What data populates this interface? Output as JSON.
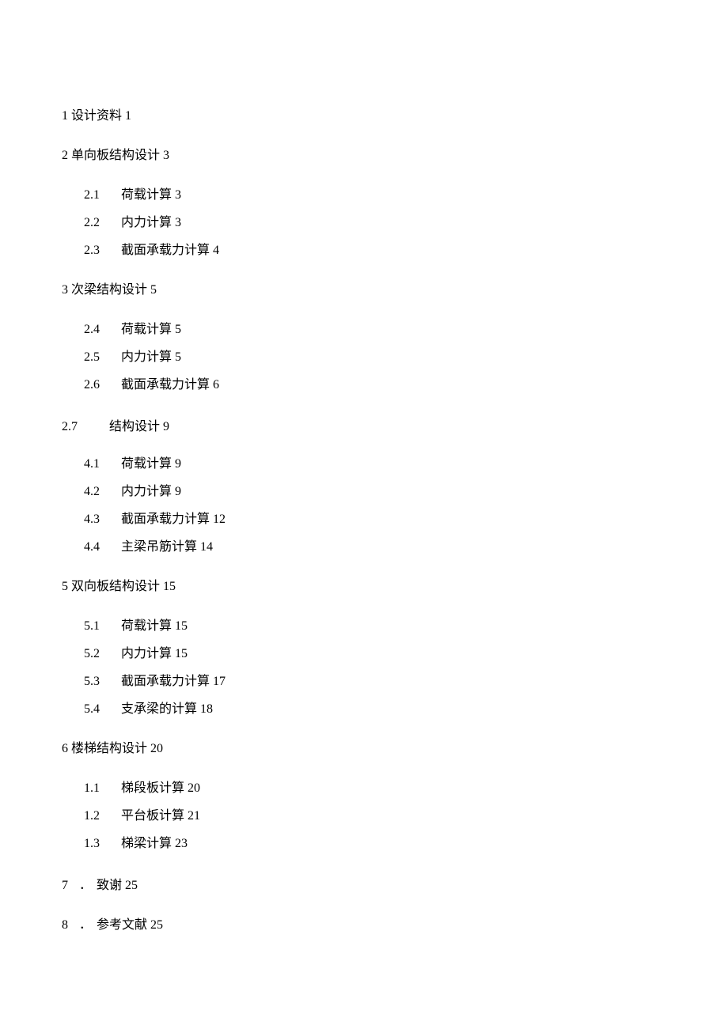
{
  "toc": {
    "s1": {
      "num": "1",
      "title": "设计资料",
      "page": "1"
    },
    "s2": {
      "num": "2",
      "title": "单向板结构设计",
      "page": "3",
      "subs": [
        {
          "num": "2.1",
          "title": "荷载计算",
          "page": "3"
        },
        {
          "num": "2.2",
          "title": "内力计算",
          "page": "3"
        },
        {
          "num": "2.3",
          "title": "截面承载力计算",
          "page": "4"
        }
      ]
    },
    "s3": {
      "num": "3",
      "title": "次梁结构设计",
      "page": "5",
      "subs": [
        {
          "num": "2.4",
          "title": "荷载计算",
          "page": "5"
        },
        {
          "num": "2.5",
          "title": "内力计算",
          "page": "5"
        },
        {
          "num": "2.6",
          "title": "截面承载力计算",
          "page": "6"
        }
      ]
    },
    "s4": {
      "num": "2.7",
      "title": "结构设计",
      "page": "9",
      "subs": [
        {
          "num": "4.1",
          "title": "荷载计算",
          "page": "9"
        },
        {
          "num": "4.2",
          "title": "内力计算",
          "page": "9"
        },
        {
          "num": "4.3",
          "title": "截面承载力计算",
          "page": "12"
        },
        {
          "num": "4.4",
          "title": "主梁吊筋计算",
          "page": "14"
        }
      ]
    },
    "s5": {
      "num": "5",
      "title": "双向板结构设计",
      "page": "15",
      "subs": [
        {
          "num": "5.1",
          "title": "荷载计算",
          "page": "15"
        },
        {
          "num": "5.2",
          "title": "内力计算",
          "page": "15"
        },
        {
          "num": "5.3",
          "title": "截面承载力计算",
          "page": "17"
        },
        {
          "num": "5.4",
          "title": "支承梁的计算",
          "page": "18"
        }
      ]
    },
    "s6": {
      "num": "6",
      "title": "楼梯结构设计",
      "page": "20",
      "subs": [
        {
          "num": "1.1",
          "title": "梯段板计算",
          "page": "20"
        },
        {
          "num": "1.2",
          "title": "平台板计算",
          "page": "21"
        },
        {
          "num": "1.3",
          "title": "梯梁计算",
          "page": "23"
        }
      ]
    },
    "s7": {
      "num": "7",
      "dot": "．",
      "title": "致谢",
      "page": "25"
    },
    "s8": {
      "num": "8",
      "dot": "．",
      "title": "参考文献",
      "page": "25"
    }
  }
}
